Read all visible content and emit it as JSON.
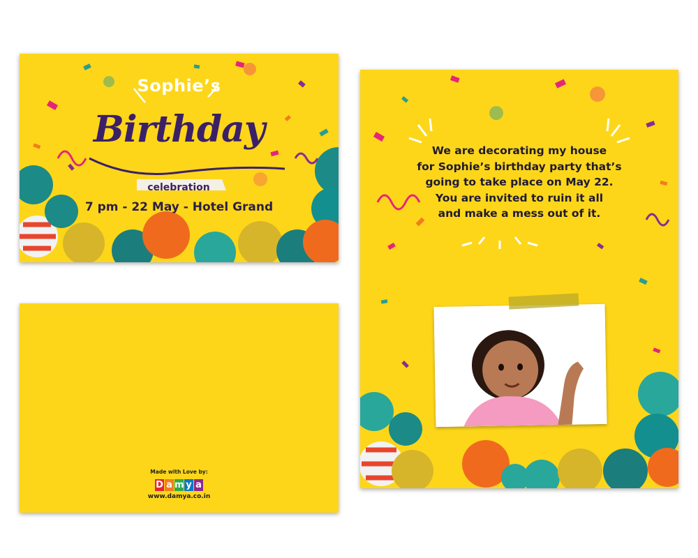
{
  "front": {
    "name": "Sophie’s",
    "title": "Birthday",
    "subtitle": "celebration",
    "details": "7 pm  -  22 May  -  Hotel Grand"
  },
  "back": {
    "made_with": "Made with Love by:",
    "logo_letters": [
      "D",
      "a",
      "m",
      "y",
      "a"
    ],
    "logo_colors": [
      "#e4262f",
      "#f47b20",
      "#2eaa47",
      "#0a78c1",
      "#8a2c8f"
    ],
    "url": "www.damya.co.in"
  },
  "inside": {
    "message": [
      "We are decorating my house",
      "for Sophie’s birthday party that’s",
      "going to take place on May 22.",
      "You are invited to ruin it all",
      "and make a mess out of it."
    ]
  },
  "colors": {
    "card_yellow": "#fdd61a",
    "title_purple": "#3b2068",
    "balloon_teal": "#1c8a86",
    "balloon_orange": "#f06a1e",
    "balloon_gold": "#d7b52a"
  }
}
